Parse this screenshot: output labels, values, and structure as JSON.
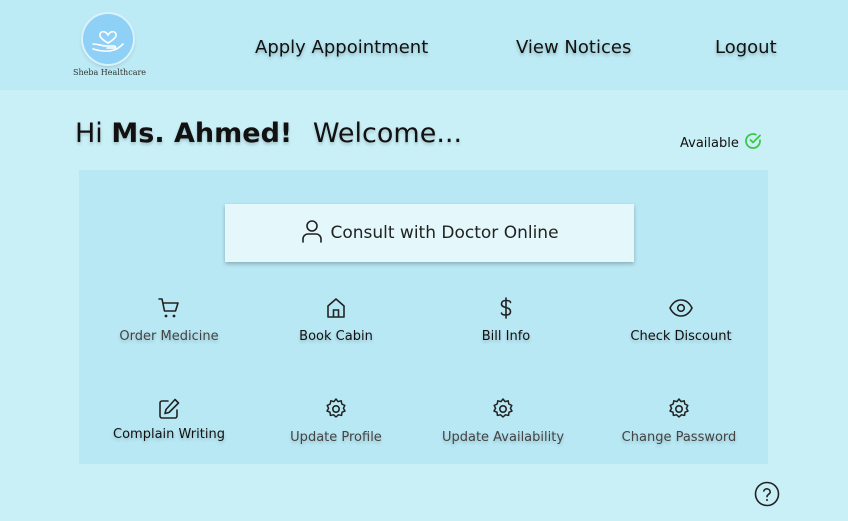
{
  "brand": {
    "name": "Sheba Healthcare"
  },
  "nav": {
    "apply": "Apply Appointment",
    "notices": "View Notices",
    "logout": "Logout"
  },
  "greeting": {
    "hi": "Hi",
    "name": "Ms. Ahmed!",
    "welcome": "Welcome..."
  },
  "status": {
    "label": "Available",
    "color": "#3cc845"
  },
  "consult": {
    "label": "Consult with Doctor Online"
  },
  "tiles": {
    "order_medicine": "Order Medicine",
    "book_cabin": "Book Cabin",
    "bill_info": "Bill Info",
    "check_discount": "Check Discount",
    "complain_writing": "Complain Writing",
    "update_profile": "Update Profile",
    "update_availability": "Update Availability",
    "change_password": "Change Password"
  },
  "colors": {
    "page_bg": "#c9eff7",
    "topbar_bg": "#bcebf5",
    "panel_bg": "#b8e8f4",
    "logo_bg": "#8fd0f6"
  }
}
